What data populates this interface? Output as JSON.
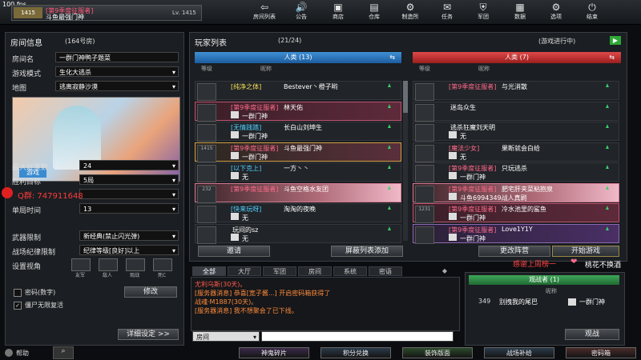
{
  "topbar": {
    "fps": "100 fps",
    "player": {
      "level_badge": "1415",
      "tag": "[第9季度征服者]",
      "name": "斗鱼最强门神",
      "lv": "Lv. 1415"
    },
    "nav": [
      {
        "label": "房间列表",
        "icon": "back-arrow-icon",
        "glyph": "⇦"
      },
      {
        "label": "公告",
        "icon": "speaker-icon",
        "glyph": "🔊"
      },
      {
        "label": "商店",
        "icon": "shop-icon",
        "glyph": "▣"
      },
      {
        "label": "仓库",
        "icon": "warehouse-icon",
        "glyph": "▤"
      },
      {
        "label": "制造所",
        "icon": "factory-icon",
        "glyph": "⚙"
      },
      {
        "label": "任务",
        "icon": "mission-icon",
        "glyph": "✉"
      },
      {
        "label": "军团",
        "icon": "clan-icon",
        "glyph": "⛨"
      },
      {
        "label": "数据",
        "icon": "data-icon",
        "glyph": "▦"
      },
      {
        "label": "选项",
        "icon": "options-gear-icon",
        "glyph": "⚙"
      },
      {
        "label": "结束",
        "icon": "power-icon",
        "glyph": "⏻"
      }
    ]
  },
  "room": {
    "title": "房间信息",
    "room_no": "(164号房)",
    "name_label": "房间名",
    "name_value": "一群门神鸭子题菜",
    "mode_label": "游戏模式",
    "mode_value": "生化大逃杀",
    "map_label": "地图",
    "map_value": "逃离寂静沙漠",
    "map_badge": "游戏",
    "max_players_label": "最大玩家数",
    "max_players_value": "24",
    "win_target_label": "胜利目标",
    "win_target_value": "5局",
    "time_label": "单局时间",
    "time_value": "13",
    "weapon_label": "武器限制",
    "weapon_value": "新经典(禁止闪光弹)",
    "rank_label": "战场纪律限制",
    "rank_value": "纪律等级[良好]以上",
    "view_label": "设置视角",
    "view_opts": [
      "友军",
      "敌人",
      "观战",
      "死C"
    ],
    "pw_label": "密码(数字)",
    "zombie_label": "僵尸无限复活",
    "edit_btn": "修改",
    "detail_btn": "详细设定 >>",
    "help_label": "帮助"
  },
  "overlay": {
    "qq_text": "Q群: 747911648"
  },
  "playerlist": {
    "title": "玩家列表",
    "count": "(21/24)",
    "status": "(游戏进行中)",
    "col_level": "等级",
    "col_nick": "昵称",
    "left_team": "人类 (13)",
    "right_team": "人类 (7)",
    "left": [
      {
        "rank": "",
        "tag": "[纯净之体]",
        "name": "Bestever丶橙子哟",
        "sub": "",
        "hl": "none",
        "tagcolor": "#f3e05a"
      },
      {
        "rank": "",
        "tag": "[第9季度征服者]",
        "name": "林天佑",
        "sub": "一群门神",
        "hl": "pink",
        "tagcolor": "#ff6a8a"
      },
      {
        "rank": "",
        "tag": "[无情践踏]",
        "name": "长白山刘坤生",
        "sub": "一群门神",
        "hl": "none",
        "tagcolor": "#4fd0ff"
      },
      {
        "rank": "1415",
        "tag": "[第9季度征服者]",
        "name": "斗鱼最强门神",
        "sub": "一群门神",
        "hl": "gold",
        "tagcolor": "#ff6a8a"
      },
      {
        "rank": "",
        "tag": "[以下克上]",
        "name": "一方丶丶",
        "sub": "无",
        "hl": "none",
        "tagcolor": "#4fd0ff"
      },
      {
        "rank": "232",
        "tag": "[第9季度征服者]",
        "name": "斗鱼空格水友团",
        "sub": "",
        "hl": "sakura",
        "tagcolor": "#ff6a8a"
      },
      {
        "rank": "",
        "tag": "[快来玩呀]",
        "name": "淘淘的夜晚",
        "sub": "无",
        "hl": "none",
        "tagcolor": "#4fd0ff"
      },
      {
        "rank": "",
        "tag": "",
        "name": "玩间的sz",
        "sub": "无",
        "hl": "none",
        "tagcolor": "#4fd0ff"
      }
    ],
    "right": [
      {
        "rank": "",
        "tag": "[第9季度征服者]",
        "name": "与光消散",
        "sub": "",
        "hl": "none",
        "tagcolor": "#ff6a8a"
      },
      {
        "rank": "",
        "tag": "",
        "name": "迷岛众生",
        "sub": "",
        "hl": "none",
        "tagcolor": "#fff"
      },
      {
        "rank": "",
        "tag": "",
        "name": "逃杀狂魔刘天明",
        "sub": "无",
        "hl": "none",
        "tagcolor": "#fff"
      },
      {
        "rank": "",
        "tag": "[魔法少女]",
        "name": "果断就会白给",
        "sub": "无",
        "hl": "none",
        "tagcolor": "#ff6a8a"
      },
      {
        "rank": "",
        "tag": "[第9季度征服者]",
        "name": "只玩逃杀",
        "sub": "一群门神",
        "hl": "none",
        "tagcolor": "#ff6a8a"
      },
      {
        "rank": "",
        "tag": "[第9季度征服者]",
        "name": "肥宅肝夹菜粘抱泉",
        "sub": "斗鱼6994349战人真刷",
        "hl": "sakura",
        "tagcolor": "#ff6a8a"
      },
      {
        "rank": "1231",
        "tag": "[第9季度征服者]",
        "name": "冷水池里的鲨鱼",
        "sub": "一群门神",
        "hl": "pink",
        "tagcolor": "#ff6a8a"
      },
      {
        "rank": "",
        "tag": "[第9季度征服者]",
        "name": "Love1Y1Y",
        "sub": "一群门神",
        "hl": "purple",
        "tagcolor": "#ff6a8a"
      }
    ],
    "btn_invite": "邀请",
    "btn_shield": "屏蔽列表添加",
    "btn_change_team": "更改阵营",
    "btn_start": "开始游戏"
  },
  "chat": {
    "tabs": [
      "全部",
      "大厅",
      "军团",
      "房间",
      "系统",
      "密语"
    ],
    "lines": [
      {
        "color": "#ff5a4a",
        "text": "尤利乌斯(30天)。"
      },
      {
        "color": "#ff8a3a",
        "text": "[服务器消息] 恭喜[宽子酱...] 开启密码箱获得了"
      },
      {
        "color": "#ff8a3a",
        "text": "战魂·M1887(30天)。"
      },
      {
        "color": "#ff8a3a",
        "text": "[服务器消息] 我不想聚会了已下线。"
      }
    ],
    "channel": "房间"
  },
  "spectator": {
    "overlay_text": "感谢上周榜一",
    "overlay_name": "桃花不换酒",
    "title": "观战者 (1)",
    "col": "昵称",
    "entry_level": "349",
    "entry_name": "别拽我的尾巴",
    "entry_clan": "一群门神",
    "btn": "观战"
  },
  "bottom": [
    "神鬼碎片",
    "积分兑换",
    "装饰版面",
    "战场补给",
    "密码箱"
  ]
}
